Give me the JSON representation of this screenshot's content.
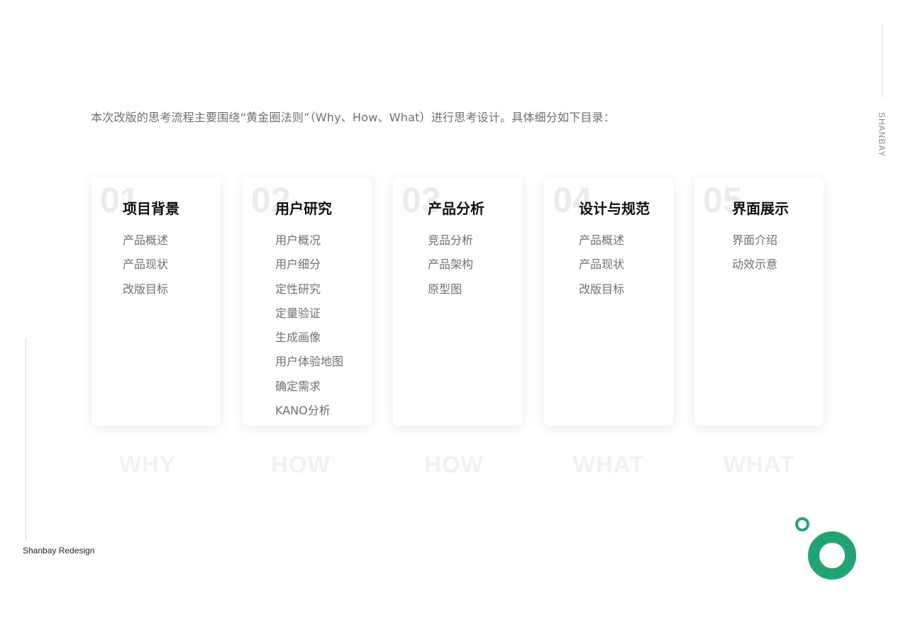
{
  "intro": "本次改版的思考流程主要围绕“黄金圈法则”（Why、How、What）进行思考设计。具体细分如下目录：",
  "brand_vertical": "SHANBAY",
  "footer_label": "Shanbay Redesign",
  "accent_color": "#22a374",
  "cards": [
    {
      "num": "01",
      "title": "项目背景",
      "items": [
        "产品概述",
        "产品现状",
        "改版目标"
      ],
      "phase": "WHY"
    },
    {
      "num": "02",
      "title": "用户研究",
      "items": [
        "用户概况",
        "用户细分",
        "定性研究",
        "定量验证",
        "生成画像",
        "用户体验地图",
        "确定需求",
        "KANO分析"
      ],
      "phase": "HOW"
    },
    {
      "num": "03",
      "title": "产品分析",
      "items": [
        "竞品分析",
        "产品架构",
        "原型图"
      ],
      "phase": "HOW"
    },
    {
      "num": "04",
      "title": "设计与规范",
      "items": [
        "产品概述",
        "产品现状",
        "改版目标"
      ],
      "phase": "WHAT"
    },
    {
      "num": "05",
      "title": "界面展示",
      "items": [
        "界面介绍",
        "动效示意"
      ],
      "phase": "WHAT"
    }
  ]
}
